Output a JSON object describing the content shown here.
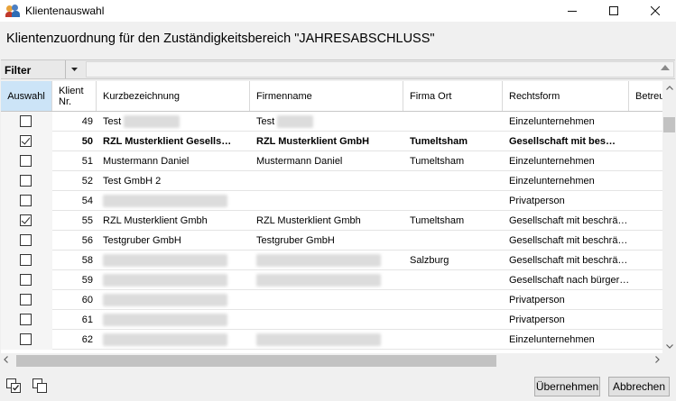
{
  "window": {
    "title": "Klientenauswahl",
    "min_icon": "minimize-icon",
    "max_icon": "maximize-icon",
    "close_icon": "close-icon"
  },
  "heading": "Klientenzuordnung für den Zuständigkeitsbereich \"JAHRESABSCHLUSS\"",
  "filter": {
    "label": "Filter",
    "dropdown_icon": "chevron-down-icon",
    "collapse_icon": "triangle-up-icon"
  },
  "columns": {
    "auswahl": "Auswahl",
    "nr_line1": "Klient",
    "nr_line2": "Nr.",
    "kurz": "Kurzbezeichnung",
    "firma": "Firmenname",
    "ort": "Firma Ort",
    "rechtsform": "Rechtsform",
    "betreuer": "Betreu"
  },
  "rows": [
    {
      "checked": false,
      "bold": false,
      "nr": "49",
      "kurz": "Test",
      "kurz_blur": true,
      "firma": "Test",
      "firma_blur": true,
      "ort": "",
      "rechtsform": "Einzelunternehmen"
    },
    {
      "checked": true,
      "bold": true,
      "nr": "50",
      "kurz": "RZL Musterklient Gesells…",
      "kurz_blur": false,
      "firma": "RZL Musterklient GmbH",
      "firma_blur": false,
      "ort": "Tumeltsham",
      "rechtsform": "Gesellschaft mit bes…"
    },
    {
      "checked": false,
      "bold": false,
      "nr": "51",
      "kurz": "Mustermann Daniel",
      "kurz_blur": false,
      "firma": "Mustermann Daniel",
      "firma_blur": false,
      "ort": "Tumeltsham",
      "rechtsform": "Einzelunternehmen"
    },
    {
      "checked": false,
      "bold": false,
      "nr": "52",
      "kurz": "Test GmbH 2",
      "kurz_blur": false,
      "firma": "",
      "firma_blur": false,
      "ort": "",
      "rechtsform": "Einzelunternehmen"
    },
    {
      "checked": false,
      "bold": false,
      "nr": "54",
      "kurz": "",
      "kurz_blur": true,
      "firma": "",
      "firma_blur": false,
      "ort": "",
      "rechtsform": "Privatperson"
    },
    {
      "checked": true,
      "bold": false,
      "nr": "55",
      "kurz": "RZL Musterklient Gmbh",
      "kurz_blur": false,
      "firma": "RZL Musterklient Gmbh",
      "firma_blur": false,
      "ort": "Tumeltsham",
      "rechtsform": "Gesellschaft mit beschrä…"
    },
    {
      "checked": false,
      "bold": false,
      "nr": "56",
      "kurz": "Testgruber GmbH",
      "kurz_blur": false,
      "firma": "Testgruber GmbH",
      "firma_blur": false,
      "ort": "",
      "rechtsform": "Gesellschaft mit beschrä…"
    },
    {
      "checked": false,
      "bold": false,
      "nr": "58",
      "kurz": "",
      "kurz_blur": true,
      "firma": "",
      "firma_blur": true,
      "ort": "Salzburg",
      "rechtsform": "Gesellschaft mit beschrä…"
    },
    {
      "checked": false,
      "bold": false,
      "nr": "59",
      "kurz": "",
      "kurz_blur": true,
      "firma": "",
      "firma_blur": true,
      "ort": "",
      "rechtsform": "Gesellschaft nach bürger…"
    },
    {
      "checked": false,
      "bold": false,
      "nr": "60",
      "kurz": "",
      "kurz_blur": true,
      "firma": "",
      "firma_blur": false,
      "ort": "",
      "rechtsform": "Privatperson"
    },
    {
      "checked": false,
      "bold": false,
      "nr": "61",
      "kurz": "",
      "kurz_blur": true,
      "firma": "",
      "firma_blur": false,
      "ort": "",
      "rechtsform": "Privatperson"
    },
    {
      "checked": false,
      "bold": false,
      "nr": "62",
      "kurz": "",
      "kurz_blur": true,
      "firma": "",
      "firma_blur": true,
      "ort": "",
      "rechtsform": "Einzelunternehmen"
    }
  ],
  "footer": {
    "select_all_icon": "select-all-icon",
    "deselect_all_icon": "deselect-all-icon",
    "ok_label": "Übernehmen",
    "cancel_label": "Abbrechen"
  }
}
